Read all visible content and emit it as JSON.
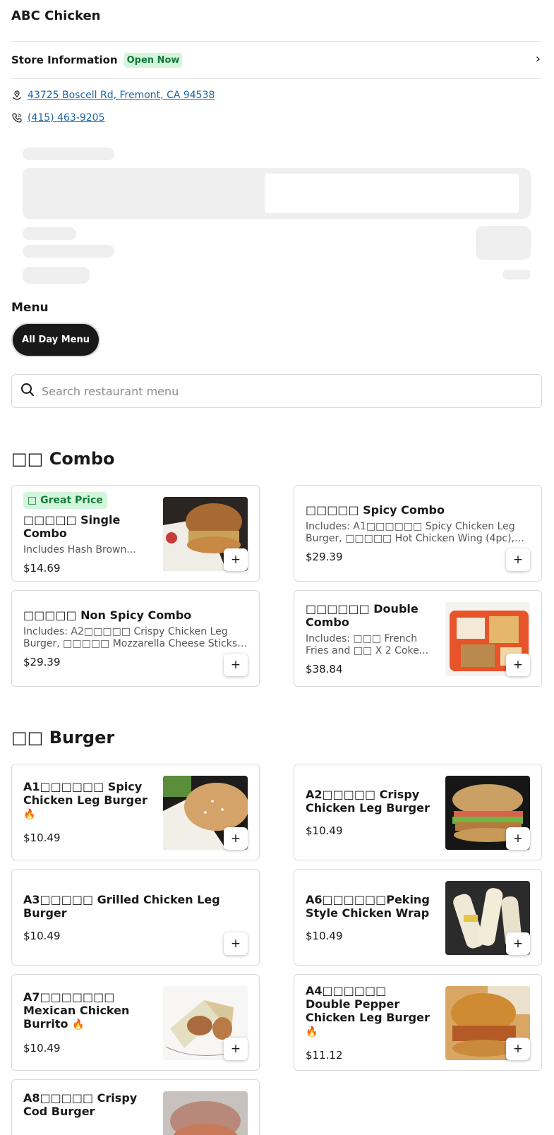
{
  "store": {
    "name": "ABC Chicken",
    "info_title": "Store Information",
    "status": "Open Now",
    "address": "43725 Boscell Rd, Fremont, CA 94538",
    "phone": "(415) 463-9205"
  },
  "menu": {
    "title": "Menu",
    "active_menu": "All Day Menu"
  },
  "search": {
    "placeholder": "Search restaurant menu"
  },
  "categories": [
    {
      "title": "□□ Combo",
      "items": [
        {
          "badge": "□ Great Price",
          "name": "□□□□□ Single Combo",
          "desc": "Includes Hash Brown...",
          "price": "$14.69"
        },
        {
          "name": "□□□□□ Spicy Combo",
          "desc": "Includes: A1□□□□□□ Spicy Chicken Leg Burger, □□□□□ Hot Chicken Wing (4pc), □□□...",
          "price": "$29.39"
        },
        {
          "name": "□□□□□ Non Spicy Combo",
          "desc": "Includes: A2□□□□□ Crispy Chicken Leg Burger, □□□□□ Mozzarella Cheese Sticks an...",
          "price": "$29.39"
        },
        {
          "name": "□□□□□□ Double Combo",
          "desc": "Includes: □□□ French Fries and □□ X 2 Coke...",
          "price": "$38.84"
        }
      ]
    },
    {
      "title": "□□ Burger",
      "items": [
        {
          "name": "A1□□□□□□ Spicy Chicken Leg Burger",
          "price": "$10.49"
        },
        {
          "name": "A2□□□□□ Crispy Chicken Leg Burger",
          "price": "$10.49"
        },
        {
          "name": "A3□□□□□ Grilled Chicken Leg Burger",
          "price": "$10.49"
        },
        {
          "name": "A6□□□□□□Peking Style Chicken Wrap",
          "price": "$10.49"
        },
        {
          "name": "A7□□□□□□□ Mexican Chicken Burrito",
          "price": "$10.49"
        },
        {
          "name": "A4□□□□□□ Double Pepper Chicken Leg Burger",
          "price": "$11.12"
        },
        {
          "name": "A8□□□□□ Crispy Cod Burger"
        }
      ]
    }
  ],
  "icons": {
    "location": "location-pin-icon",
    "phone": "phone-icon",
    "search": "search-icon",
    "chevron": "chevron-right-icon",
    "add": "plus-icon",
    "spicy": "flame-icon"
  },
  "colors": {
    "open_badge_bg": "#d3f5dc",
    "open_badge_text": "#157a3a",
    "link": "#1a66a8",
    "pill_bg": "#191919",
    "spicy": "#d23a2b"
  }
}
